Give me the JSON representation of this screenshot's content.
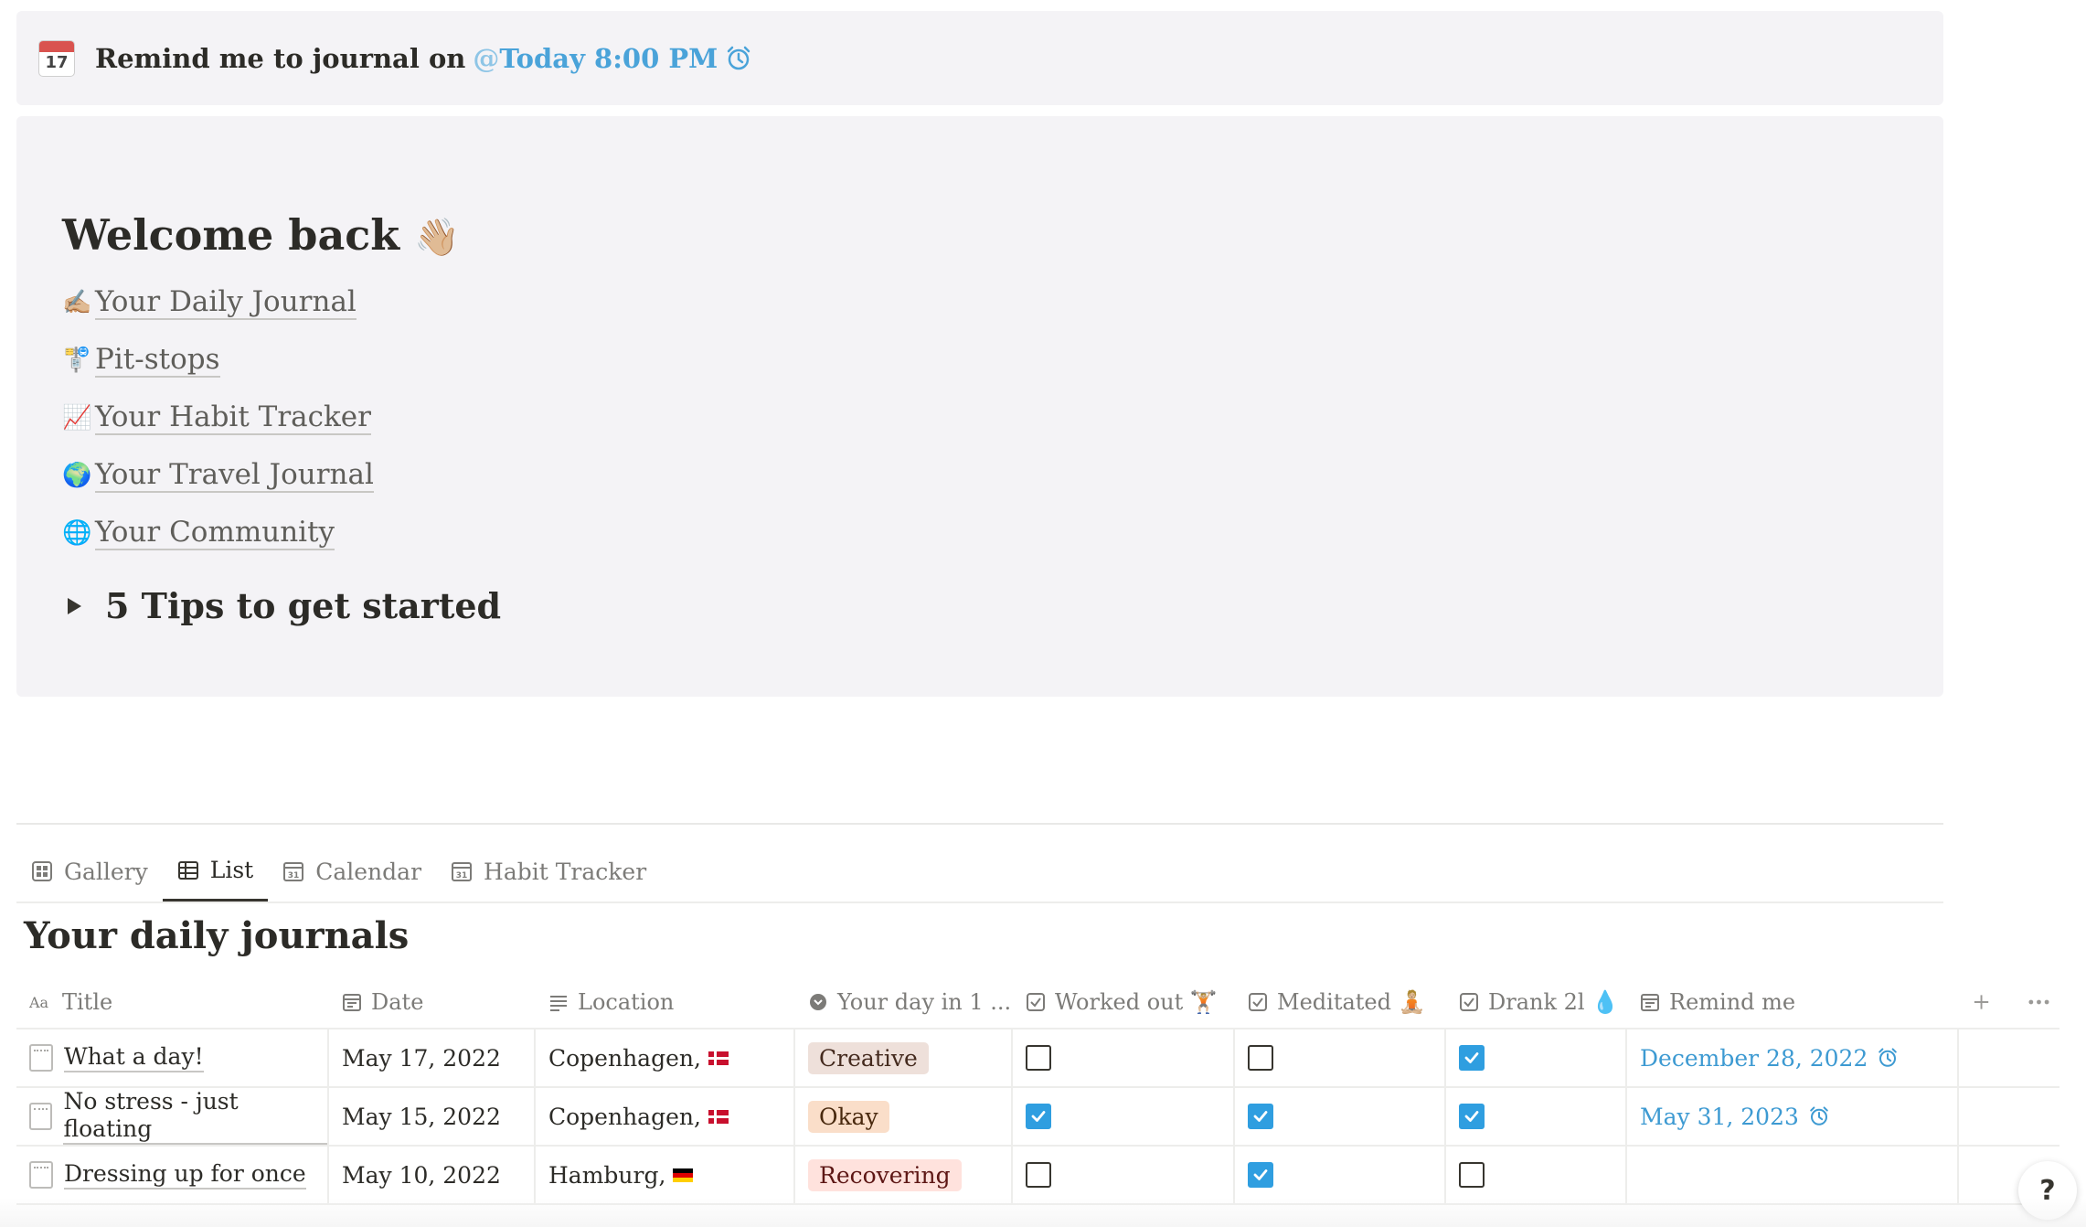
{
  "reminder": {
    "text": "Remind me to journal on",
    "mention_at": "@",
    "mention_value": "Today 8:00 PM",
    "calendar_day": "17",
    "icon": "alarm-clock-icon"
  },
  "welcome": {
    "heading": "Welcome back",
    "heading_emoji": "👋🏼",
    "links": [
      {
        "emoji": "✍🏼",
        "label": "Your Daily Journal"
      },
      {
        "emoji": "🚏",
        "label": "Pit-stops"
      },
      {
        "emoji": "📈",
        "label": "Your Habit Tracker"
      },
      {
        "emoji": "🌍",
        "label": "Your Travel Journal"
      },
      {
        "emoji": "🌐",
        "label": "Your Community"
      }
    ],
    "toggle_title": "5 Tips to get started"
  },
  "views": {
    "tabs": [
      {
        "label": "Gallery",
        "icon": "gallery-icon"
      },
      {
        "label": "List",
        "icon": "table-icon",
        "active": true
      },
      {
        "label": "Calendar",
        "icon": "calendar-icon"
      },
      {
        "label": "Habit Tracker",
        "icon": "calendar-icon"
      }
    ]
  },
  "database": {
    "title": "Your daily journals",
    "columns": [
      {
        "label": "Title",
        "icon": "text-icon"
      },
      {
        "label": "Date",
        "icon": "date-icon"
      },
      {
        "label": "Location",
        "icon": "text-lines-icon"
      },
      {
        "label": "Your day in 1 ...",
        "icon": "select-icon"
      },
      {
        "label": "Worked out 🏋🏼",
        "icon": "checkbox-icon"
      },
      {
        "label": "Meditated 🧘🏼",
        "icon": "checkbox-icon"
      },
      {
        "label": "Drank 2l 💧",
        "icon": "checkbox-icon"
      },
      {
        "label": "Remind me",
        "icon": "date-icon"
      }
    ],
    "rows": [
      {
        "title": "What a day!",
        "date": "May 17, 2022",
        "location": "Copenhagen,",
        "flag": "dk",
        "mood": "Creative",
        "mood_bg": "#eee0da",
        "mood_fg": "#442a1e",
        "worked_out": false,
        "meditated": false,
        "drank": true,
        "remind": "December 28, 2022"
      },
      {
        "title": "No stress - just floating",
        "date": "May 15, 2022",
        "location": "Copenhagen,",
        "flag": "dk",
        "mood": "Okay",
        "mood_bg": "#fadec9",
        "mood_fg": "#49290e",
        "worked_out": true,
        "meditated": true,
        "drank": true,
        "remind": "May 31, 2023"
      },
      {
        "title": "Dressing up for once",
        "date": "May 10, 2022",
        "location": "Hamburg,",
        "flag": "de",
        "mood": "Recovering",
        "mood_bg": "#ffe2dd",
        "mood_fg": "#5d1715",
        "worked_out": false,
        "meditated": true,
        "drank": false,
        "remind": ""
      }
    ],
    "add_icon": "plus-icon",
    "more_icon": "more-icon"
  },
  "help_label": "?",
  "colors": {
    "accent": "#4aa3d9",
    "checkbox_on": "#2f9ee0",
    "callout_bg": "#f4f3f6"
  }
}
